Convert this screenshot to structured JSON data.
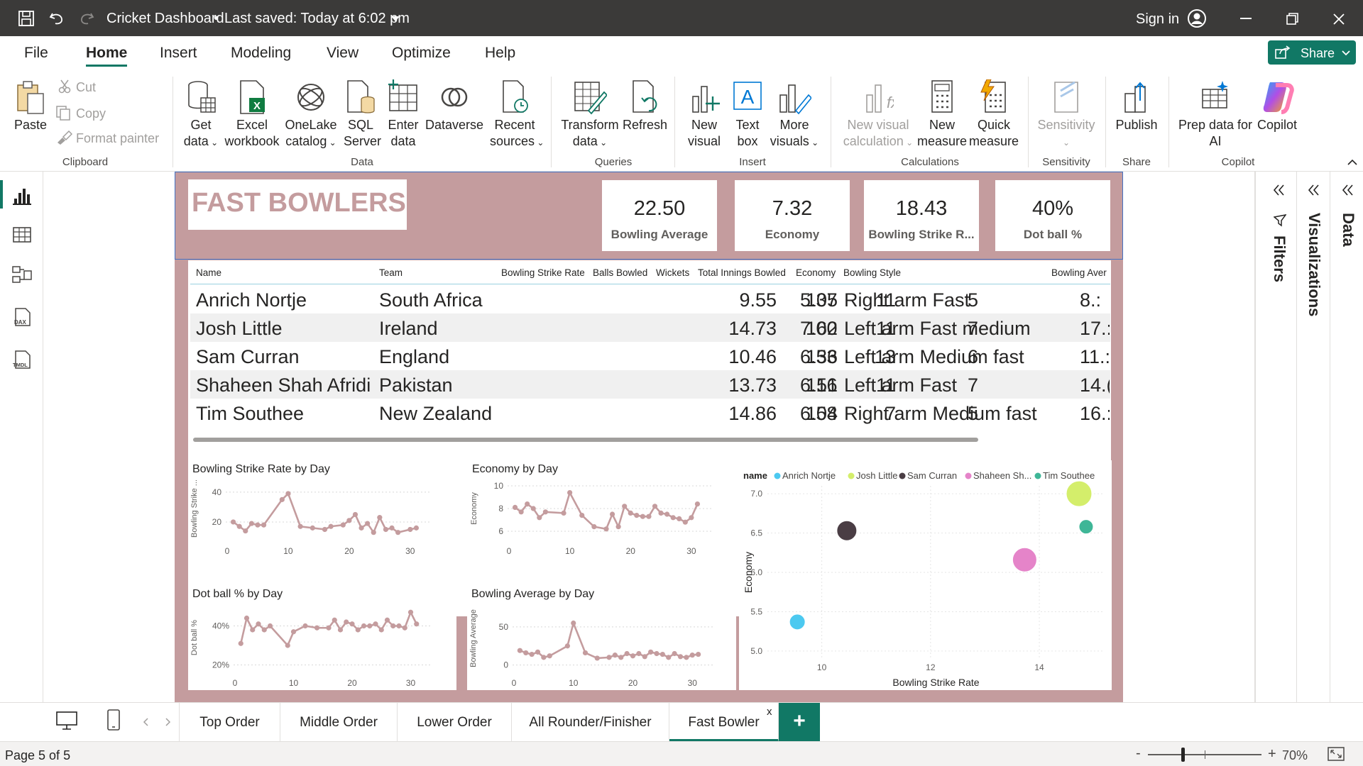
{
  "titlebar": {
    "title": "Cricket Dashboard",
    "saved": "Last saved: Today at 6:02 pm",
    "sign_in": "Sign in"
  },
  "menu": {
    "tabs": [
      "File",
      "Home",
      "Insert",
      "Modeling",
      "View",
      "Optimize",
      "Help"
    ],
    "share_label": "Share"
  },
  "ribbon": {
    "clipboard": {
      "paste": "Paste",
      "cut": "Cut",
      "copy": "Copy",
      "format_painter": "Format painter",
      "group": "Clipboard"
    },
    "data": {
      "get_data_1": "Get",
      "get_data_2": "data",
      "excel_1": "Excel",
      "excel_2": "workbook",
      "onelake_1": "OneLake",
      "onelake_2": "catalog",
      "sql_1": "SQL",
      "sql_2": "Server",
      "enter_1": "Enter",
      "enter_2": "data",
      "dataverse": "Dataverse",
      "recent_1": "Recent",
      "recent_2": "sources",
      "group": "Data"
    },
    "queries": {
      "transform_1": "Transform",
      "transform_2": "data",
      "refresh": "Refresh",
      "group": "Queries"
    },
    "insert": {
      "newvisual_1": "New",
      "newvisual_2": "visual",
      "textbox_1": "Text",
      "textbox_2": "box",
      "more_1": "More",
      "more_2": "visuals",
      "group": "Insert"
    },
    "calculations": {
      "nvc_1": "New visual",
      "nvc_2": "calculation",
      "nm_1": "New",
      "nm_2": "measure",
      "qm_1": "Quick",
      "qm_2": "measure",
      "group": "Calculations"
    },
    "sensitivity": {
      "label": "Sensitivity",
      "group": "Sensitivity"
    },
    "share": {
      "publish": "Publish",
      "group": "Share"
    },
    "copilot": {
      "prep_1": "Prep data for",
      "prep_2": "AI",
      "copilot": "Copilot",
      "group": "Copilot"
    }
  },
  "report": {
    "title": "FAST BOWLERS",
    "cards": [
      {
        "value": "22.50",
        "label": "Bowling Average"
      },
      {
        "value": "7.32",
        "label": "Economy"
      },
      {
        "value": "18.43",
        "label": "Bowling Strike R..."
      },
      {
        "value": "40%",
        "label": "Dot ball %"
      }
    ],
    "table": {
      "headers": [
        "Name",
        "Team",
        "Bowling Strike Rate",
        "Balls Bowled",
        "Wickets",
        "Total Innings Bowled",
        "Economy",
        "Bowling Style",
        "Bowling Aver"
      ],
      "rows": [
        [
          "Anrich Nortje",
          "South Africa",
          "9.55",
          "105",
          "11",
          "5",
          "5.37",
          "Right arm Fast",
          "8.:"
        ],
        [
          "Josh Little",
          "Ireland",
          "14.73",
          "162",
          "11",
          "7",
          "7.00",
          "Left arm Fast medium",
          "17.:"
        ],
        [
          "Sam Curran",
          "England",
          "10.46",
          "136",
          "13",
          "6",
          "6.53",
          "Left arm Medium fast",
          "11.:"
        ],
        [
          "Shaheen Shah Afridi",
          "Pakistan",
          "13.73",
          "151",
          "11",
          "7",
          "6.16",
          "Left arm Fast",
          "14.("
        ],
        [
          "Tim Southee",
          "New Zealand",
          "14.86",
          "104",
          "7",
          "5",
          "6.58",
          "Right arm Medium fast",
          "16.:"
        ]
      ]
    }
  },
  "chart_data": [
    {
      "type": "line",
      "title": "Bowling Strike Rate by Day",
      "ylabel": "Bowling Strike ...",
      "xlabel": "",
      "xlim": [
        0,
        32
      ],
      "ylim": [
        10,
        48
      ],
      "xticks": [
        "0",
        "10",
        "20",
        "30"
      ],
      "yticks": [
        "20",
        "40"
      ],
      "x": [
        1,
        2,
        3,
        4,
        5,
        6,
        9,
        10,
        12,
        14,
        16,
        17,
        19,
        20,
        21,
        22,
        23,
        24,
        25,
        26,
        27,
        28,
        30,
        31
      ],
      "values": [
        20,
        17,
        14,
        19,
        18,
        18,
        35,
        39,
        17,
        16,
        15,
        17,
        18,
        21,
        25,
        16,
        19,
        13,
        23,
        15,
        16,
        13,
        15,
        16
      ],
      "color": "#c49c9e"
    },
    {
      "type": "line",
      "title": "Economy by Day",
      "ylabel": "Economy",
      "xlabel": "",
      "xlim": [
        0,
        32
      ],
      "ylim": [
        5.5,
        10.5
      ],
      "xticks": [
        "0",
        "10",
        "20",
        "30"
      ],
      "yticks": [
        "6",
        "8",
        "10"
      ],
      "x": [
        1,
        2,
        3,
        4,
        5,
        6,
        9,
        10,
        12,
        14,
        16,
        17,
        18,
        19,
        20,
        21,
        22,
        23,
        24,
        25,
        26,
        27,
        28,
        29,
        30,
        31
      ],
      "values": [
        8.1,
        7.7,
        8.4,
        8.0,
        7.2,
        7.7,
        7.6,
        9.4,
        7.4,
        6.4,
        6.2,
        7.5,
        6.4,
        8.2,
        7.6,
        7.4,
        7.3,
        7.3,
        8.2,
        7.6,
        7.5,
        7.2,
        7.1,
        6.8,
        7.2,
        8.4
      ],
      "color": "#c49c9e"
    },
    {
      "type": "line",
      "title": "Dot ball % by Day",
      "ylabel": "Dot ball %",
      "xlabel": "",
      "xlim": [
        0,
        32
      ],
      "ylim": [
        18,
        50
      ],
      "xticks": [
        "0",
        "10",
        "20",
        "30"
      ],
      "yticks": [
        "20%",
        "40%"
      ],
      "x": [
        1,
        2,
        3,
        4,
        5,
        6,
        9,
        10,
        12,
        14,
        16,
        17,
        18,
        19,
        20,
        21,
        22,
        23,
        24,
        25,
        26,
        27,
        28,
        29,
        30,
        31
      ],
      "values": [
        31,
        44,
        38,
        41,
        38,
        40,
        30,
        37,
        40,
        39,
        39,
        43,
        38,
        42,
        41,
        38,
        40,
        40,
        41,
        38,
        43,
        40,
        40,
        39,
        47,
        41
      ],
      "color": "#c49c9e"
    },
    {
      "type": "line",
      "title": "Bowling Average by Day",
      "ylabel": "Bowling Average",
      "xlabel": "",
      "xlim": [
        0,
        32
      ],
      "ylim": [
        -5,
        75
      ],
      "xticks": [
        "0",
        "10",
        "20",
        "30"
      ],
      "yticks": [
        "0",
        "50"
      ],
      "x": [
        1,
        2,
        3,
        4,
        5,
        6,
        9,
        10,
        12,
        14,
        16,
        17,
        18,
        19,
        20,
        21,
        22,
        23,
        24,
        25,
        26,
        27,
        28,
        29,
        30,
        31
      ],
      "values": [
        19,
        16,
        14,
        17,
        10,
        12,
        25,
        55,
        16,
        9,
        10,
        13,
        10,
        15,
        12,
        15,
        11,
        17,
        15,
        14,
        10,
        15,
        11,
        10,
        13,
        14
      ],
      "color": "#c49c9e"
    },
    {
      "type": "scatter",
      "title": "",
      "legend_title": "name",
      "xlabel": "Bowling Strike Rate",
      "ylabel": "Economy",
      "xlim": [
        9.0,
        15.2
      ],
      "ylim": [
        4.9,
        7.1
      ],
      "xticks": [
        "10",
        "12",
        "14"
      ],
      "yticks": [
        "5.0",
        "5.5",
        "6.0",
        "6.5",
        "7.0"
      ],
      "series": [
        {
          "name": "Anrich Nortje",
          "x": 9.55,
          "y": 5.37,
          "size": 11,
          "color": "#4cc9f0"
        },
        {
          "name": "Josh Little",
          "x": 14.73,
          "y": 7.0,
          "size": 18,
          "color": "#d4ee6b"
        },
        {
          "name": "Sam Curran",
          "x": 10.46,
          "y": 6.53,
          "size": 14,
          "color": "#4a3d44"
        },
        {
          "name": "Shaheen Sh...",
          "x": 13.73,
          "y": 6.16,
          "size": 17,
          "color": "#e584c9"
        },
        {
          "name": "Tim Southee",
          "x": 14.86,
          "y": 6.58,
          "size": 10,
          "color": "#3fb697"
        }
      ]
    }
  ],
  "panes": {
    "filters": "Filters",
    "visualizations": "Visualizations",
    "data": "Data"
  },
  "pages": {
    "tabs": [
      "Top Order",
      "Middle Order",
      "Lower Order",
      "All Rounder/Finisher",
      "Fast Bowler"
    ],
    "close": "x",
    "add": "+"
  },
  "status": {
    "page": "Page 5 of 5",
    "zoom": "70%",
    "minus": "-",
    "plus": "+"
  }
}
